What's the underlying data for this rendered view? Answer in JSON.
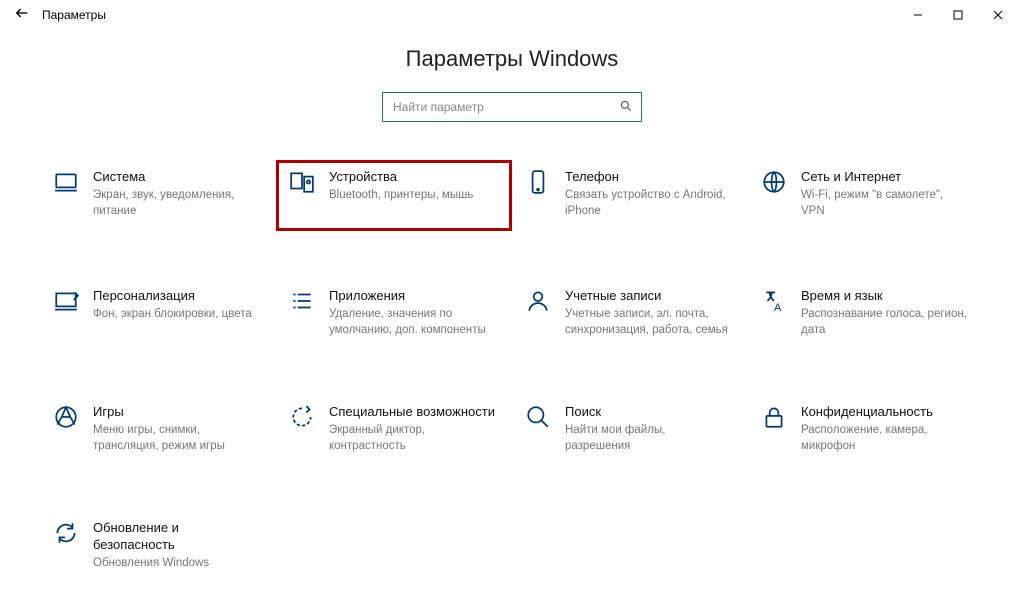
{
  "window": {
    "title": "Параметры"
  },
  "page": {
    "heading": "Параметры Windows",
    "search_placeholder": "Найти параметр"
  },
  "tiles": {
    "system": {
      "label": "Система",
      "desc": "Экран, звук, уведомления, питание"
    },
    "devices": {
      "label": "Устройства",
      "desc": "Bluetooth, принтеры, мышь"
    },
    "phone": {
      "label": "Телефон",
      "desc": "Связать устройство с Android, iPhone"
    },
    "network": {
      "label": "Сеть и Интернет",
      "desc": "Wi-Fi, режим \"в самолете\", VPN"
    },
    "personalization": {
      "label": "Персонализация",
      "desc": "Фон, экран блокировки, цвета"
    },
    "apps": {
      "label": "Приложения",
      "desc": "Удаление, значения по умолчанию, доп. компоненты"
    },
    "accounts": {
      "label": "Учетные записи",
      "desc": "Учетные записи, эл. почта, синхронизация, работа, семья"
    },
    "time": {
      "label": "Время и язык",
      "desc": "Распознавание голоса, регион, дата"
    },
    "gaming": {
      "label": "Игры",
      "desc": "Меню игры, снимки, трансляция, режим игры"
    },
    "ease": {
      "label": "Специальные возможности",
      "desc": "Экранный диктор, контрастность"
    },
    "search": {
      "label": "Поиск",
      "desc": "Найти мои файлы, разрешения"
    },
    "privacy": {
      "label": "Конфиденциальность",
      "desc": "Расположение, камера, микрофон"
    },
    "update": {
      "label": "Обновление и безопасность",
      "desc": "Обновления Windows"
    }
  }
}
